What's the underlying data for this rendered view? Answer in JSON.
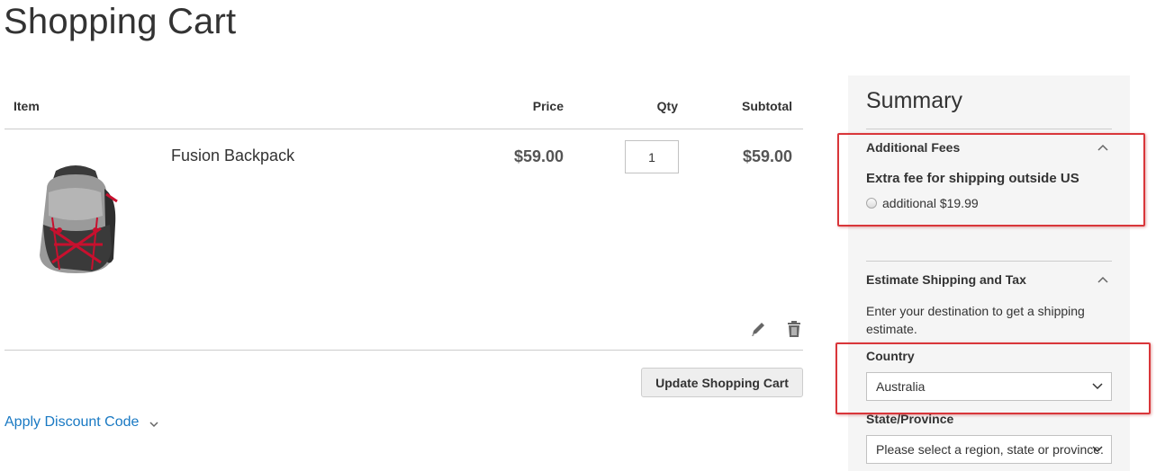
{
  "page": {
    "title": "Shopping Cart"
  },
  "cart": {
    "headers": {
      "item": "Item",
      "price": "Price",
      "qty": "Qty",
      "subtotal": "Subtotal"
    },
    "items": [
      {
        "name": "Fusion Backpack",
        "price": "$59.00",
        "qty": "1",
        "subtotal": "$59.00"
      }
    ],
    "update_label": "Update Shopping Cart",
    "discount_label": "Apply Discount Code"
  },
  "summary": {
    "title": "Summary",
    "fees": {
      "title": "Additional Fees",
      "heading": "Extra fee for shipping outside US",
      "option_label": "additional $19.99",
      "option_selected": false
    },
    "shipping": {
      "title": "Estimate Shipping and Tax",
      "description": "Enter your destination to get a shipping estimate.",
      "country_label": "Country",
      "country_value": "Australia",
      "state_label": "State/Province",
      "state_value": "Please select a region, state or province."
    }
  },
  "colors": {
    "link": "#1979c3",
    "highlight": "#d9363a",
    "summary_bg": "#f5f5f5",
    "accent_red": "#c8102e"
  },
  "icons": [
    "pencil-icon",
    "trash-icon",
    "chevron-down-icon",
    "chevron-up-icon"
  ]
}
